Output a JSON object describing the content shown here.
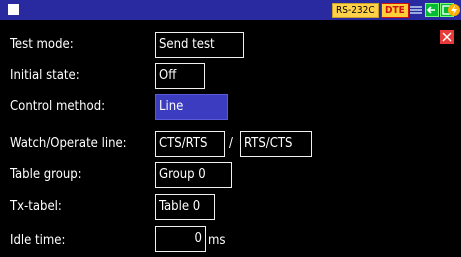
{
  "status_bar": {
    "interface": "RS-232C",
    "mode_badge": "DTE",
    "accent_color": "#2a2aa0"
  },
  "form": {
    "test_mode": {
      "label": "Test mode:",
      "value": "Send test"
    },
    "initial_state": {
      "label": "Initial state:",
      "value": "Off"
    },
    "control_method": {
      "label": "Control method:",
      "value": "Line"
    },
    "watch_operate_line": {
      "label": "Watch/Operate line:",
      "watch": "CTS/RTS",
      "separator": "/",
      "operate": "RTS/CTS"
    },
    "table_group": {
      "label": "Table group:",
      "value": "Group 0"
    },
    "tx_table": {
      "label": "Tx-tabel:",
      "value": "Table 0"
    },
    "idle_time": {
      "label": "Idle time:",
      "value": "0",
      "unit": "ms"
    }
  }
}
